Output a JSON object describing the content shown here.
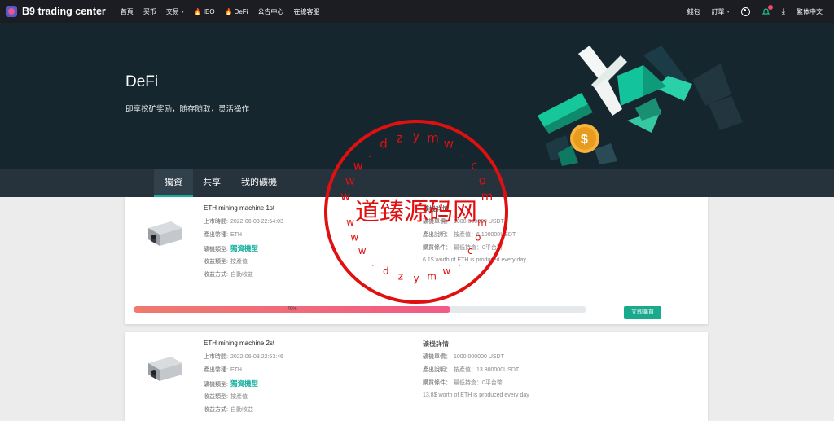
{
  "brand": {
    "name": "B9 trading center"
  },
  "nav": {
    "items": [
      {
        "label": "首頁"
      },
      {
        "label": "买币"
      },
      {
        "label": "交易",
        "caret": "▾"
      },
      {
        "label": "IEO",
        "fire": "🔥"
      },
      {
        "label": "DeFi",
        "fire": "🔥"
      },
      {
        "label": "公告中心"
      },
      {
        "label": "在線客服"
      }
    ],
    "right": {
      "wallet": "錢包",
      "orders": "訂單",
      "orders_caret": "▾",
      "download": "⤓",
      "language": "繁体中文"
    }
  },
  "hero": {
    "title": "DeFi",
    "subtitle": "即享挖矿奖励，随存随取，灵活操作"
  },
  "tabs": [
    {
      "label": "獨資"
    },
    {
      "label": "共享"
    },
    {
      "label": "我的礦機"
    }
  ],
  "machines": [
    {
      "name": "ETH mining machine 1st",
      "list_time_label": "上市時間:",
      "list_time": "2022-06-03 22:54:03",
      "coin_label": "產出幣種:",
      "coin": "ETH",
      "type_label": "礦機類型:",
      "type": "獨資機型",
      "income_label": "收益類型:",
      "income": "按產值",
      "method_label": "收益方式:",
      "method": "自動收益",
      "details_title": "礦機詳情",
      "price_label": "礦機單價：",
      "price": "1000.000000 USDT",
      "output_label": "產出說明：",
      "output": "按產值：6.100000USDT",
      "cond_label": "購買條件：",
      "cond": "最低持倉：0平台幣",
      "note": "6.1$ worth of ETH is produced every day",
      "progress": 70,
      "progress_label": "70%",
      "buy_label": "立即購買"
    },
    {
      "name": "ETH mining machine 2st",
      "list_time_label": "上市時間:",
      "list_time": "2022-06-03 22:53:46",
      "coin_label": "產出幣種:",
      "coin": "ETH",
      "type_label": "礦機類型:",
      "type": "獨資機型",
      "income_label": "收益類型:",
      "income": "按產值",
      "method_label": "收益方式:",
      "method": "自動收益",
      "details_title": "礦機詳情",
      "price_label": "礦機單價：",
      "price": "1000.000000 USDT",
      "output_label": "產出說明：",
      "output": "按產值：13.800000USDT",
      "cond_label": "購買條件：",
      "cond": "最低持倉：0平台幣",
      "note": "13.8$ worth of ETH is produced every day"
    }
  ],
  "watermark": {
    "center": "道臻源码网",
    "ring_letters": [
      "w",
      "w",
      "w",
      ".",
      "d",
      "z",
      "y",
      "m",
      "w",
      ".",
      "c",
      "o",
      "m"
    ]
  },
  "colors": {
    "accent": "#18b0a1",
    "progress": "#f15b86",
    "nav_bg": "#1b1d22",
    "hero_bg": "#15262f",
    "stamp": "#e01010"
  }
}
